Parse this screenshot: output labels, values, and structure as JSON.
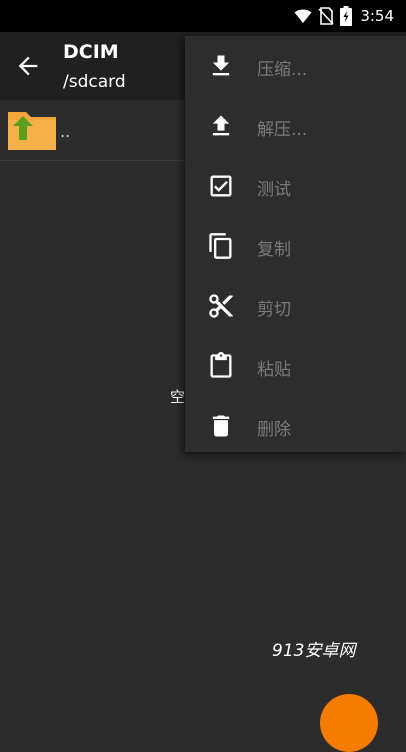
{
  "status_bar": {
    "time": "3:54",
    "icons": [
      "wifi-icon",
      "no-sim-icon",
      "battery-charging-icon"
    ]
  },
  "app_bar": {
    "back_icon": "arrow-back-icon",
    "title": "DCIM",
    "subtitle": "/sdcard"
  },
  "file_list": {
    "items": [
      {
        "icon": "folder-up-icon",
        "name": ".."
      }
    ],
    "empty_text": "空"
  },
  "context_menu": {
    "items": [
      {
        "label": "压缩...",
        "icon": "download-icon"
      },
      {
        "label": "解压...",
        "icon": "upload-icon"
      },
      {
        "label": "测试",
        "icon": "check-box-icon"
      },
      {
        "label": "复制",
        "icon": "copy-icon"
      },
      {
        "label": "剪切",
        "icon": "scissors-icon"
      },
      {
        "label": "粘贴",
        "icon": "clipboard-icon"
      },
      {
        "label": "删除",
        "icon": "trash-icon"
      }
    ]
  },
  "watermark": "913安卓网",
  "colors": {
    "background": "#2c2c2c",
    "app_bar": "#202020",
    "menu_bg": "#2d2d2d",
    "menu_text_disabled": "#7a7a7a",
    "fab": "#f57c00",
    "folder": "#f2a73b",
    "folder_arrow": "#5a9e1c"
  }
}
